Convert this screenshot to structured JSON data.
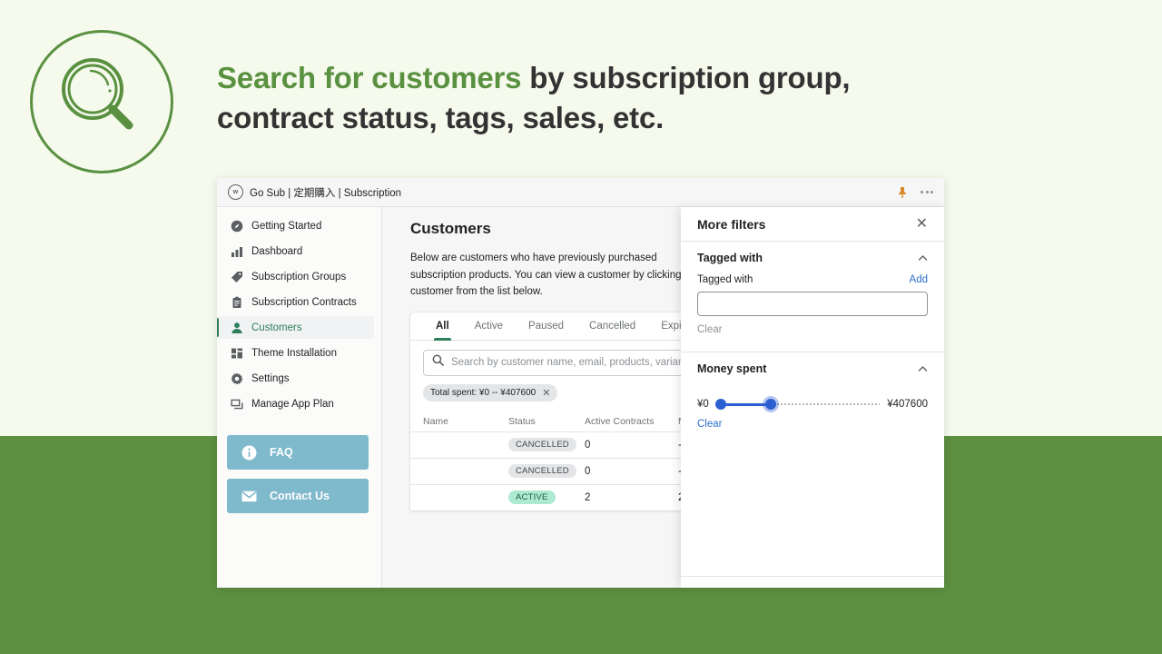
{
  "hero": {
    "accent_text": "Search for customers",
    "rest_text": " by subscription group, contract status, tags, sales, etc.",
    "accent_color": "#5a9141",
    "logo_icon": "magnifier-icon"
  },
  "window": {
    "titlebar": {
      "app_mark": "w",
      "title": "Go Sub | 定期購入 | Subscription",
      "pin_icon": "pin-icon",
      "more_icon": "more-horizontal-icon"
    }
  },
  "sidebar": {
    "items": [
      {
        "label": "Getting Started",
        "icon": "compass-icon",
        "selected": false
      },
      {
        "label": "Dashboard",
        "icon": "bar-chart-icon",
        "selected": false
      },
      {
        "label": "Subscription Groups",
        "icon": "tag-icon",
        "selected": false
      },
      {
        "label": "Subscription Contracts",
        "icon": "clipboard-icon",
        "selected": false
      },
      {
        "label": "Customers",
        "icon": "person-icon",
        "selected": true
      },
      {
        "label": "Theme Installation",
        "icon": "layout-icon",
        "selected": false
      },
      {
        "label": "Settings",
        "icon": "gear-icon",
        "selected": false
      },
      {
        "label": "Manage App Plan",
        "icon": "cards-icon",
        "selected": false
      }
    ],
    "buttons": [
      {
        "label": "FAQ",
        "icon": "info-icon"
      },
      {
        "label": "Contact Us",
        "icon": "envelope-icon"
      }
    ],
    "button_color": "#7fb9cc"
  },
  "main": {
    "page_title": "Customers",
    "page_description": "Below are customers who have previously purchased subscription products. You can view a customer by clicking on a customer from the list below.",
    "tabs": [
      {
        "label": "All",
        "active": true
      },
      {
        "label": "Active",
        "active": false
      },
      {
        "label": "Paused",
        "active": false
      },
      {
        "label": "Cancelled",
        "active": false
      },
      {
        "label": "Expired",
        "active": false
      }
    ],
    "search": {
      "placeholder": "Search by customer name, email, products, variants,",
      "icon": "search-icon"
    },
    "applied_filter_chip": {
      "label": "Total spent: ¥0 -- ¥407600",
      "remove_icon": "close-icon"
    },
    "table": {
      "columns": [
        "Name",
        "Status",
        "Active Contracts",
        "N"
      ],
      "rows": [
        {
          "name": "",
          "status": "CANCELLED",
          "status_type": "cancelled",
          "active_contracts": "0",
          "next": "-"
        },
        {
          "name": "",
          "status": "CANCELLED",
          "status_type": "cancelled",
          "active_contracts": "0",
          "next": "-"
        },
        {
          "name": "",
          "status": "ACTIVE",
          "status_type": "active",
          "active_contracts": "2",
          "next": "2"
        }
      ]
    }
  },
  "filters_panel": {
    "title": "More filters",
    "close_icon": "close-icon",
    "sections": [
      {
        "title": "Tagged with",
        "collapse_icon": "chevron-up-icon",
        "field_label": "Tagged with",
        "add_label": "Add",
        "input_value": "",
        "clear_label": "Clear"
      },
      {
        "title": "Money spent",
        "collapse_icon": "chevron-up-icon",
        "min_label": "¥0",
        "max_label": "¥407600",
        "clear_label": "Clear",
        "slider_color": "#2c5fd1"
      }
    ]
  }
}
